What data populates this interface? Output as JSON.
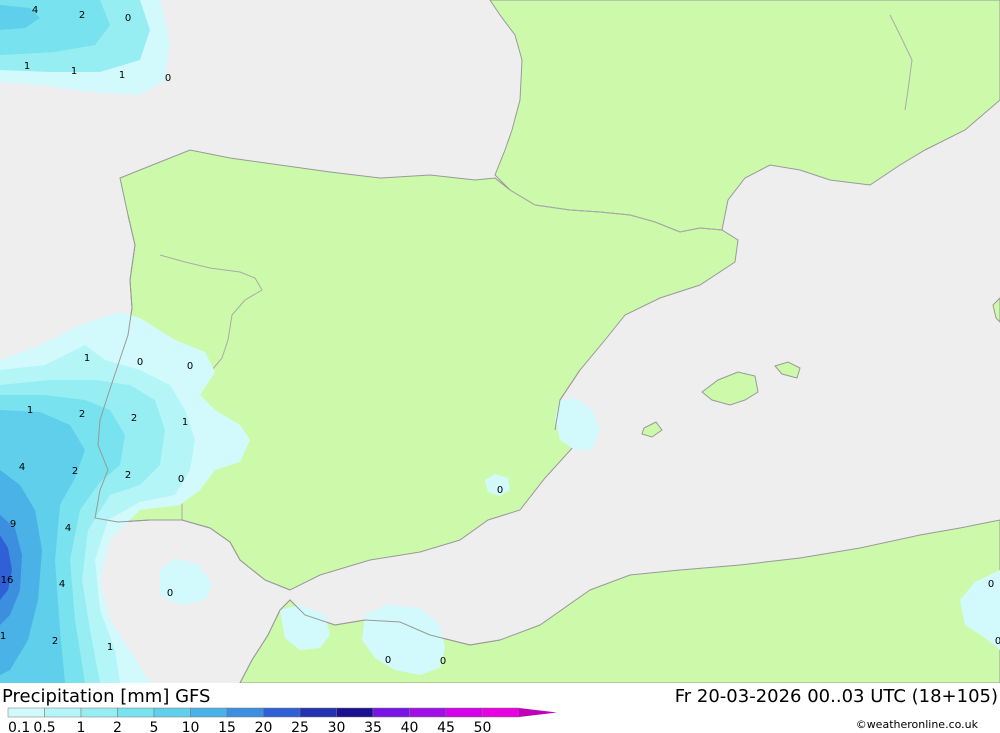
{
  "title": "Precipitation [mm] GFS",
  "run_info": "Fr 20-03-2026 00..03 UTC (18+105)",
  "credit": "©weatheronline.co.uk",
  "colors": {
    "sea": "#eeeeee",
    "land": "#ccfaaa",
    "coast": "#999999"
  },
  "scale": {
    "labels": [
      "0.1",
      "0.5",
      "1",
      "2",
      "5",
      "10",
      "15",
      "20",
      "25",
      "30",
      "35",
      "40",
      "45",
      "50"
    ],
    "colors": [
      "#d2fafc",
      "#b4f5f8",
      "#96eef2",
      "#78e2ee",
      "#5fcfeb",
      "#4ab2e6",
      "#3c8fdf",
      "#3060d5",
      "#2232b0",
      "#1a1090",
      "#7a14e6",
      "#a010e6",
      "#d400e8",
      "#e800e0",
      "#c000b8"
    ]
  },
  "precip_values": [
    "4",
    "2",
    "0",
    "1",
    "1",
    "1",
    "0",
    "1",
    "0",
    "0",
    "1",
    "2",
    "2",
    "1",
    "4",
    "2",
    "2",
    "0",
    "9",
    "4",
    "16",
    "4",
    "0",
    "1",
    "2",
    "1",
    "0",
    "0",
    "0",
    "0",
    "0"
  ]
}
